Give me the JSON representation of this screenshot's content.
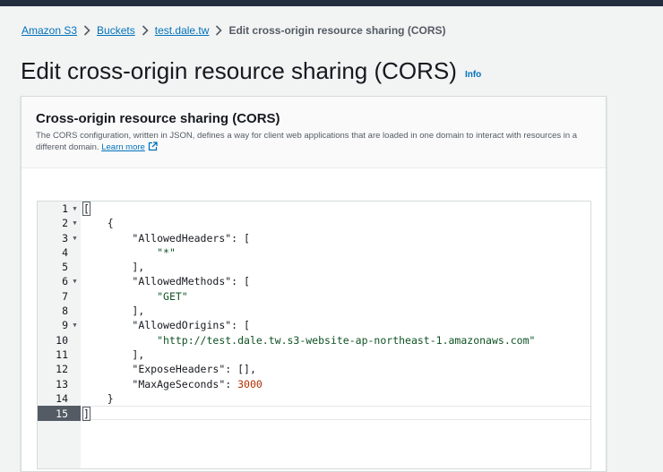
{
  "breadcrumb": {
    "items": [
      "Amazon S3",
      "Buckets",
      "test.dale.tw"
    ],
    "current": "Edit cross-origin resource sharing (CORS)"
  },
  "page": {
    "title": "Edit cross-origin resource sharing (CORS)",
    "info": "Info"
  },
  "panel": {
    "title": "Cross-origin resource sharing (CORS)",
    "description": "The CORS configuration, written in JSON, defines a way for client web applications that are loaded in one domain to interact with resources in a different domain.",
    "learn_more": "Learn more"
  },
  "editor": {
    "active_line": 15,
    "lines": [
      {
        "n": "1",
        "fold": true,
        "parts": [
          [
            "",
            "["
          ]
        ]
      },
      {
        "n": "2",
        "fold": true,
        "parts": [
          [
            "",
            "    {"
          ]
        ]
      },
      {
        "n": "3",
        "fold": true,
        "parts": [
          [
            "",
            "        "
          ],
          [
            "key",
            "\"AllowedHeaders\""
          ],
          [
            "",
            ": ["
          ]
        ]
      },
      {
        "n": "4",
        "fold": false,
        "parts": [
          [
            "",
            "            "
          ],
          [
            "str",
            "\"*\""
          ]
        ]
      },
      {
        "n": "5",
        "fold": false,
        "parts": [
          [
            "",
            "        ],"
          ]
        ]
      },
      {
        "n": "6",
        "fold": true,
        "parts": [
          [
            "",
            "        "
          ],
          [
            "key",
            "\"AllowedMethods\""
          ],
          [
            "",
            ": ["
          ]
        ]
      },
      {
        "n": "7",
        "fold": false,
        "parts": [
          [
            "",
            "            "
          ],
          [
            "str",
            "\"GET\""
          ]
        ]
      },
      {
        "n": "8",
        "fold": false,
        "parts": [
          [
            "",
            "        ],"
          ]
        ]
      },
      {
        "n": "9",
        "fold": true,
        "parts": [
          [
            "",
            "        "
          ],
          [
            "key",
            "\"AllowedOrigins\""
          ],
          [
            "",
            ": ["
          ]
        ]
      },
      {
        "n": "10",
        "fold": false,
        "parts": [
          [
            "",
            "            "
          ],
          [
            "str",
            "\"http://test.dale.tw.s3-website-ap-northeast-1.amazonaws.com\""
          ]
        ]
      },
      {
        "n": "11",
        "fold": false,
        "parts": [
          [
            "",
            "        ],"
          ]
        ]
      },
      {
        "n": "12",
        "fold": false,
        "parts": [
          [
            "",
            "        "
          ],
          [
            "key",
            "\"ExposeHeaders\""
          ],
          [
            "",
            ": [],"
          ]
        ]
      },
      {
        "n": "13",
        "fold": false,
        "parts": [
          [
            "",
            "        "
          ],
          [
            "key",
            "\"MaxAgeSeconds\""
          ],
          [
            "",
            ": "
          ],
          [
            "num",
            "3000"
          ]
        ]
      },
      {
        "n": "14",
        "fold": false,
        "parts": [
          [
            "",
            "    }"
          ]
        ]
      },
      {
        "n": "15",
        "fold": false,
        "parts": [
          [
            "",
            "]"
          ]
        ]
      }
    ]
  }
}
